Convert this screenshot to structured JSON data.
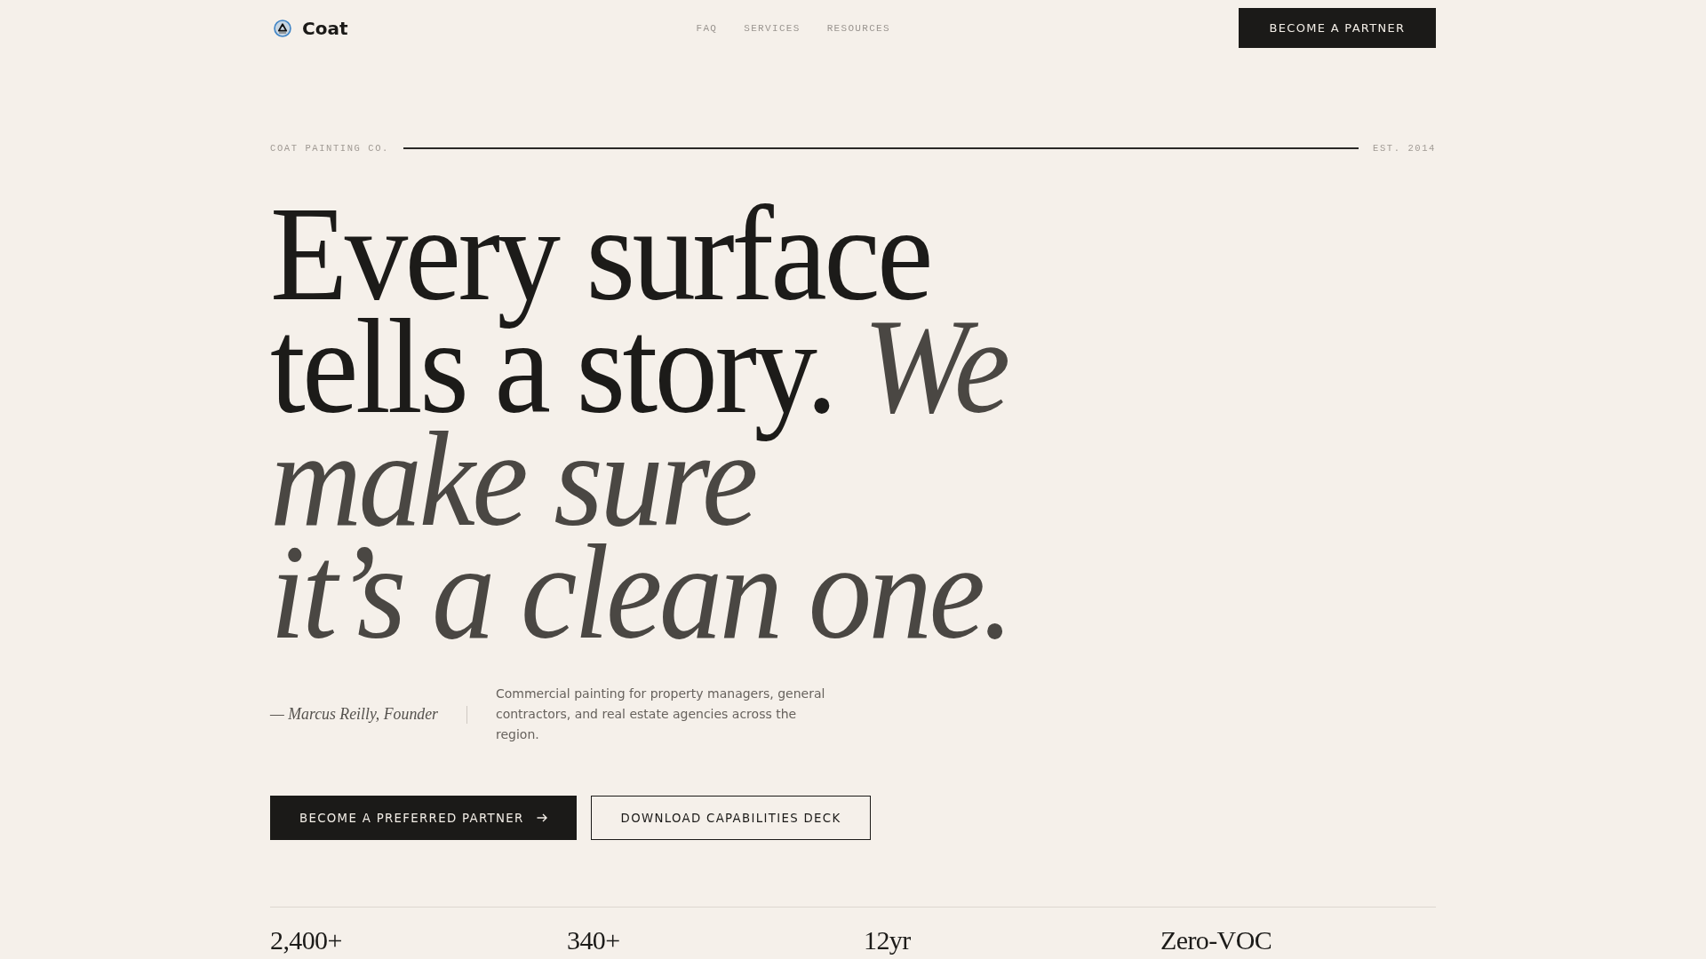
{
  "brand": {
    "name": "Coat"
  },
  "nav": {
    "links": [
      "FAQ",
      "SERVICES",
      "RESOURCES"
    ],
    "cta": "BECOME A PARTNER"
  },
  "hero": {
    "eyebrow": "COAT PAINTING CO.",
    "established": "EST. 2014",
    "headline": [
      "Every surface",
      "tells a story. *We*",
      "*make sure*",
      "*it’s a clean one.*"
    ],
    "attribution": "— Marcus Reilly, Founder",
    "description": "Commercial painting for property managers, general contractors, and real estate agencies across the region.",
    "buttons": [
      {
        "label": "BECOME A PREFERRED PARTNER",
        "kind": "primary"
      },
      {
        "label": "DOWNLOAD CAPABILITIES DECK",
        "kind": "secondary"
      }
    ]
  },
  "stats": [
    "2,400+",
    "340+",
    "12yr",
    "Zero-VOC"
  ]
}
